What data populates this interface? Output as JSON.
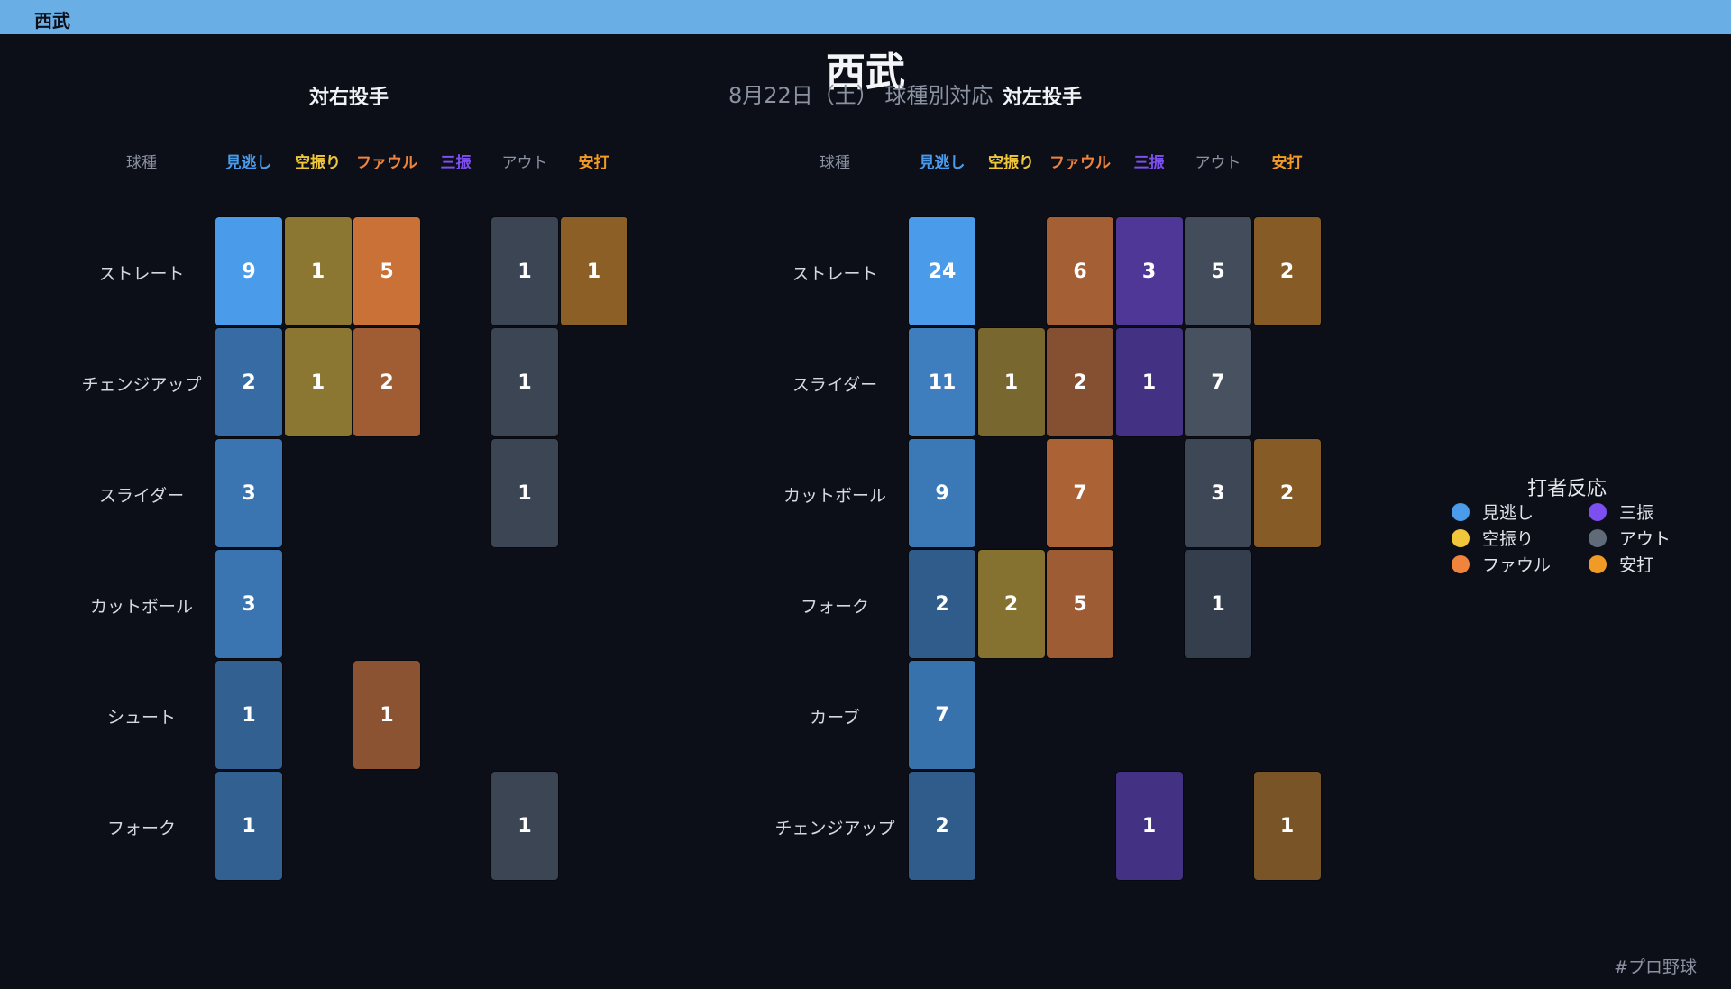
{
  "header": {
    "team": "西武"
  },
  "footer": {
    "tag": "#プロ野球"
  },
  "colors": {
    "見逃し": "#4a9be9",
    "空振り": "#f0c63a",
    "ファウル": "#f0843c",
    "三振": "#7d4ff0",
    "アウト": "#5f6b79",
    "安打": "#f29a26"
  },
  "chart_data": {
    "type": "heatmap",
    "title": "西武",
    "subtitle": "8月22日（土） 球種別対応",
    "row_header": "球種",
    "columns": [
      "見逃し",
      "空振り",
      "ファウル",
      "三振",
      "アウト",
      "安打"
    ],
    "legend": {
      "title": "打者反応",
      "placement": "right"
    },
    "panels": [
      {
        "title": "対右投手",
        "rows": [
          "ストレート",
          "チェンジアップ",
          "スライダー",
          "カットボール",
          "シュート",
          "フォーク"
        ],
        "values": [
          [
            9,
            1,
            5,
            null,
            1,
            1
          ],
          [
            2,
            1,
            2,
            null,
            1,
            null
          ],
          [
            3,
            null,
            null,
            null,
            1,
            null
          ],
          [
            3,
            null,
            null,
            null,
            null,
            null
          ],
          [
            1,
            null,
            1,
            null,
            null,
            null
          ],
          [
            1,
            null,
            null,
            null,
            1,
            null
          ]
        ]
      },
      {
        "title": "対左投手",
        "rows": [
          "ストレート",
          "スライダー",
          "カットボール",
          "フォーク",
          "カーブ",
          "チェンジアップ"
        ],
        "values": [
          [
            24,
            null,
            6,
            3,
            5,
            2
          ],
          [
            11,
            1,
            2,
            1,
            7,
            null
          ],
          [
            9,
            null,
            7,
            null,
            3,
            2
          ],
          [
            2,
            2,
            5,
            null,
            1,
            null
          ],
          [
            7,
            null,
            null,
            null,
            null,
            null
          ],
          [
            2,
            null,
            null,
            1,
            null,
            1
          ]
        ]
      }
    ]
  }
}
